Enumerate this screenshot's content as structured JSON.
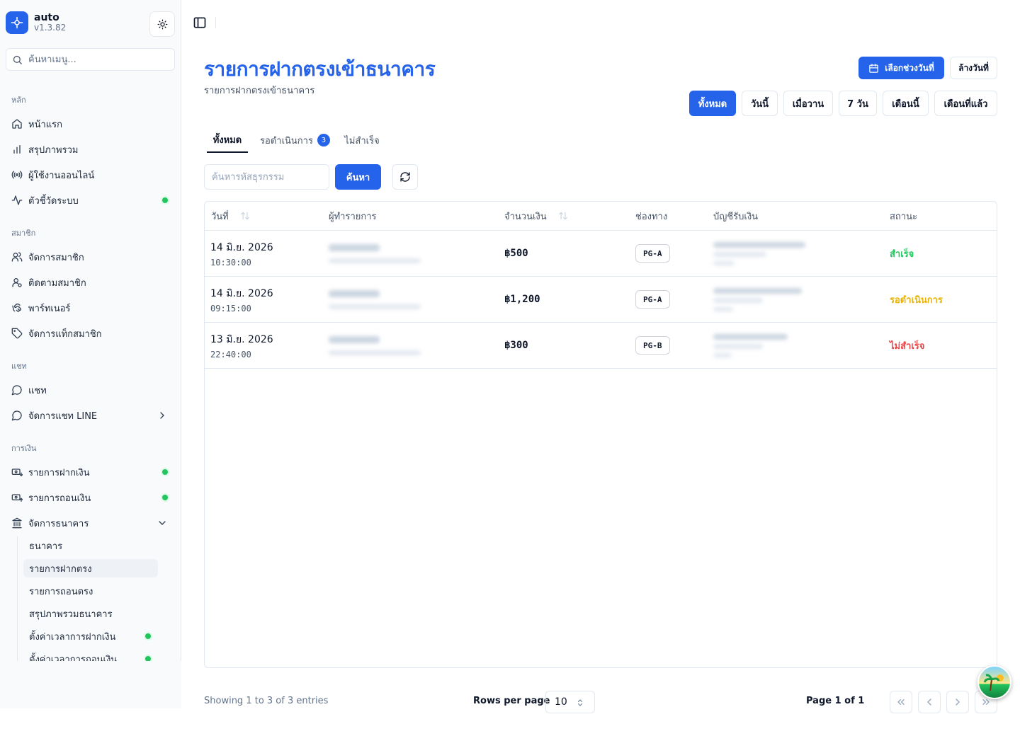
{
  "app": {
    "name": "auto",
    "version": "v1.3.82"
  },
  "sidebar": {
    "search_placeholder": "ค้นหาเมนู...",
    "groups": {
      "main": "หลัก",
      "members": "สมาชิก",
      "chat": "แชท",
      "finance": "การเงิน"
    },
    "items": {
      "home": "หน้าแรก",
      "overview": "สรุปภาพรวม",
      "online_users": "ผู้ใช้งานออนไลน์",
      "system_metrics": "ตัวชี้วัดระบบ",
      "manage_members": "จัดการสมาชิก",
      "track_members": "ติดตามสมาชิก",
      "partners": "พาร์ทเนอร์",
      "member_tags": "จัดการแท็กสมาชิก",
      "chat": "แชท",
      "line_chat": "จัดการแชท LINE",
      "deposits": "รายการฝากเงิน",
      "withdrawals": "รายการถอนเงิน",
      "bank_management": "จัดการธนาคาร"
    },
    "bank_sub": {
      "banks": "ธนาคาร",
      "direct_deposits": "รายการฝากตรง",
      "direct_withdrawals": "รายการถอนตรง",
      "bank_overview": "สรุปภาพรวมธนาคาร",
      "deposit_schedule": "ตั้งค่าเวลาการฝากเงิน",
      "withdraw_schedule": "ตั้งค่าเวลาการถอนเงิน"
    }
  },
  "page": {
    "title": "รายการฝากตรงเข้าธนาคาร",
    "subtitle": "รายการฝากตรงเข้าธนาคาร"
  },
  "date_controls": {
    "pick_range": "เลือกช่วงวันที่",
    "clear": "ล้างวันที่",
    "presets": [
      "ทั้งหมด",
      "วันนี้",
      "เมื่อวาน",
      "7 วัน",
      "เดือนนี้",
      "เดือนที่แล้ว"
    ]
  },
  "tabs": {
    "all": "ทั้งหมด",
    "pending": "รอดำเนินการ",
    "pending_count": "3",
    "failed": "ไม่สำเร็จ"
  },
  "search": {
    "placeholder": "ค้นหารหัสธุรกรรม",
    "button": "ค้นหา"
  },
  "table": {
    "headers": {
      "date": "วันที่",
      "payer": "ผู้ทำรายการ",
      "amount": "จำนวนเงิน",
      "channel": "ช่องทาง",
      "account": "บัญชีรับเงิน",
      "status": "สถานะ"
    },
    "rows": [
      {
        "date": "14 มิ.ย. 2026",
        "time": "10:30:00",
        "amount": "฿500",
        "channel": "PG-A",
        "status": "สำเร็จ",
        "status_color": "#22c55e"
      },
      {
        "date": "14 มิ.ย. 2026",
        "time": "09:15:00",
        "amount": "฿1,200",
        "channel": "PG-A",
        "status": "รอดำเนินการ",
        "status_color": "#eab308"
      },
      {
        "date": "13 มิ.ย. 2026",
        "time": "22:40:00",
        "amount": "฿300",
        "channel": "PG-B",
        "status": "ไม่สำเร็จ",
        "status_color": "#ef4444"
      }
    ]
  },
  "footer": {
    "showing": "Showing 1 to 3 of 3 entries",
    "rows_per_page_label": "Rows per page",
    "rows_per_page": "10",
    "page_label": "Page 1 of 1"
  },
  "colors": {
    "accent": "#2563eb",
    "success": "#22c55e",
    "pending": "#eab308",
    "failed": "#ef4444"
  }
}
